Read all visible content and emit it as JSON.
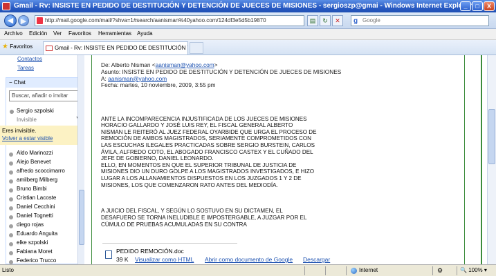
{
  "window": {
    "title": "Gmail - Rv: INSISTE EN PEDIDO DE DESTITUCIÓN Y DETENCIÓN DE JUECES DE MISIONES - sergioszp@gmai - Windows Internet Explorer",
    "minimize_label": "_",
    "maximize_label": "□",
    "close_label": "X"
  },
  "address_bar": {
    "url": "http://mail.google.com/mail/?shva=1#search/aanisman%40yahoo.com/124df3e5d5b19870",
    "search_placeholder": "Google",
    "search_brand": "g"
  },
  "menu": [
    "Archivo",
    "Edición",
    "Ver",
    "Favoritos",
    "Herramientas",
    "Ayuda"
  ],
  "favorites_label": "Favoritos",
  "tab": {
    "label": "Gmail - Rv: INSISTE EN PEDIDO DE DESTITUCIÓN Y D..."
  },
  "sidebar": {
    "links": [
      "Contactos",
      "Tareas"
    ],
    "chat": {
      "header": "Chat",
      "search_placeholder": "Buscar, añadir o invitar",
      "user_name": "Sergio szpolski",
      "user_status": "Invisible",
      "invisible_note": "Eres invisible.",
      "visible_link": "Volver a estar visible"
    },
    "contacts": [
      "Aldo Marinozzi",
      "Alejo Benevet",
      "alfredo scoccimarro",
      "amilberg Milberg",
      "Bruno Bimbi",
      "Cristian Lacoste",
      "Daniel Cecchini",
      "Daniel Tognetti",
      "diego rojas",
      "Eduardo Anguita",
      "elke szpolski",
      "Fabiana Moret",
      "Federico Trucco"
    ]
  },
  "message": {
    "from_label": "De: Alberto Nisman <",
    "from_email": "aanisman@yahoo.com",
    "from_close": ">",
    "subject": "Asunto: INSISTE EN PEDIDO DE DESTITUCIÓN Y DETENCIÓN DE JUECES DE MISIONES",
    "to_label": "A: ",
    "to_email": "aanisman@yahoo.com",
    "date": "Fecha: martes, 10 noviembre, 2009, 3:55 pm",
    "body_p1": "ANTE LA INCOMPARECENCIA INJUSTIFICADA DE LOS JUECES DE MISIONES\nHORACIO GALLARDO Y JOSÉ LUIS REY, EL FISCAL GENERAL ALBERTO\nNISMAN LE REITERÓ AL JUEZ FEDERAL OYARBIDE QUE URGA EL PROCESO DE\nREMOCIÓN DE AMBOS MAGISTRADOS, SERIAMENTE COMPROMETIDOS CON\nLAS ESCUCHAS ILEGALES PRACTICADAS SOBRE SERGIO BURSTEIN, CARLOS\nÁVILA, ALFREDO COTO, EL ABOGADO FRANCISCO CASTEX Y EL CUÑADO DEL\nJEFE DE GOBIERNO, DANIEL LEONARDO.\nELLO, EN MOMENTOS EN QUE EL SUPERIOR TRIBUNAL DE JUSTICIA DE\nMISIONES DIO UN DURO GOLPE A LOS MAGISTRADOS INVESTIGADOS, E HIZO\nLUGAR A LOS ALLANAMIENTOS DISPUESTOS EN LOS JUZGADOS 1 Y 2 DE\nMISIONES, LOS QUE COMENZARON RATO ANTES DEL MEDIODÍA.",
    "body_p2": "A JUICIO DEL FISCAL, Y SEGÚN LO SOSTUVO EN SU DICTAMEN, EL\nDESAFUERO SE TORNA INELUDIBLE E IMPOSTERGABLE, A JUZGAR POR EL\nCÚMULO DE PRUEBAS ACUMULADAS EN SU CONTRA"
  },
  "attachment": {
    "filename": "PEDIDO REMOCIÓN.doc",
    "size": "39 K",
    "view_link": "Visualizar como HTML",
    "open_link": "Abrir como documento de Google",
    "download_link": "Descargar"
  },
  "status_bar": {
    "text": "Listo",
    "zone": "Internet",
    "zoom": "100%"
  }
}
